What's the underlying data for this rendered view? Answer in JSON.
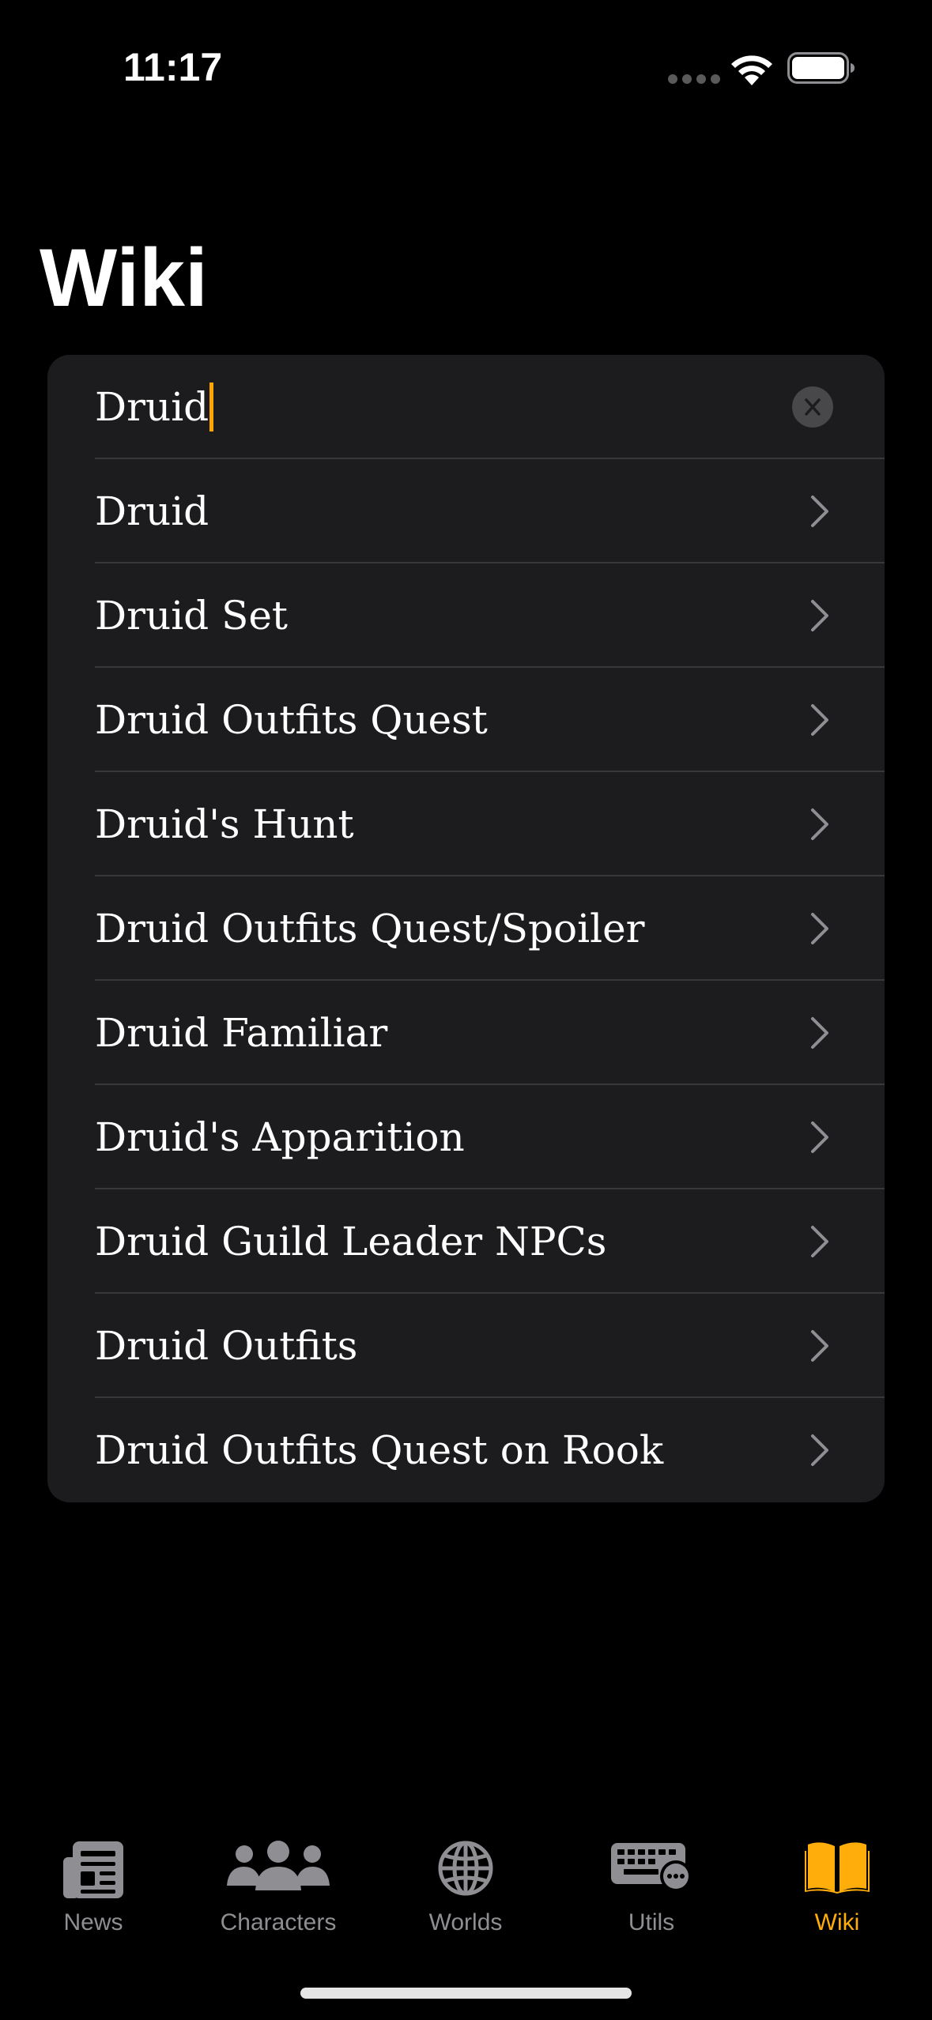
{
  "status_bar": {
    "time": "11:17"
  },
  "page": {
    "title": "Wiki"
  },
  "search": {
    "value": "Druid"
  },
  "results": [
    {
      "label": "Druid"
    },
    {
      "label": "Druid Set"
    },
    {
      "label": "Druid Outfits Quest"
    },
    {
      "label": "Druid's Hunt"
    },
    {
      "label": "Druid Outfits Quest/Spoiler"
    },
    {
      "label": "Druid Familiar"
    },
    {
      "label": "Druid's Apparition"
    },
    {
      "label": "Druid Guild Leader NPCs"
    },
    {
      "label": "Druid Outfits"
    },
    {
      "label": "Druid Outfits Quest on Rook"
    }
  ],
  "tabs": [
    {
      "label": "News",
      "icon": "newspaper-icon"
    },
    {
      "label": "Characters",
      "icon": "people-icon"
    },
    {
      "label": "Worlds",
      "icon": "globe-icon"
    },
    {
      "label": "Utils",
      "icon": "keyboard-icon"
    },
    {
      "label": "Wiki",
      "icon": "book-icon"
    }
  ],
  "colors": {
    "accent": "#ffad0a",
    "card_background": "#1c1c1e",
    "inactive_tab": "#8e8e93"
  }
}
